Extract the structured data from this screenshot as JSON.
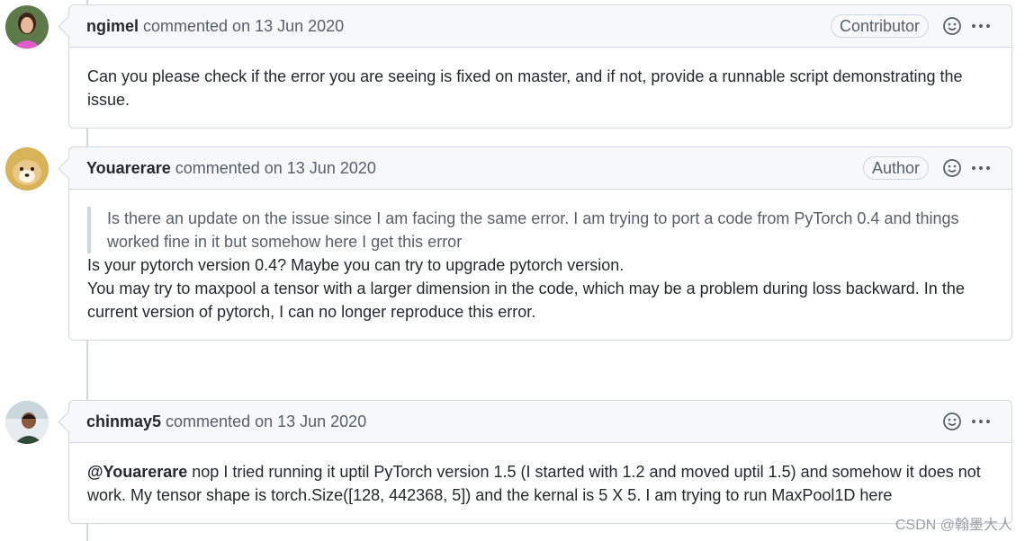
{
  "comments": [
    {
      "author": "ngimel",
      "meta": "commented on 13 Jun 2020",
      "badge": "Contributor",
      "body": "Can you please check if the error you are seeing is fixed on master, and if not, provide a runnable script demonstrating the issue."
    },
    {
      "author": "Youarerare",
      "meta": "commented on 13 Jun 2020",
      "badge": "Author",
      "quote": "Is there an update on the issue since I am facing the same error. I am trying to port a code from PyTorch 0.4 and things worked fine in it but somehow here I get this error",
      "body_line1": "Is your pytorch version 0.4? Maybe you can try to upgrade pytorch version.",
      "body_line2": "You may try to maxpool a tensor with a larger dimension in the code, which may be a problem during loss backward. In the current version of pytorch, I can no longer reproduce this error."
    },
    {
      "author": "chinmay5",
      "meta": "commented on 13 Jun 2020",
      "mention": "@Youarerare",
      "body": " nop I tried running it uptil PyTorch version 1.5 (I started with 1.2 and moved uptil 1.5) and somehow it does not work. My tensor shape is torch.Size([128, 442368, 5]) and the kernal is 5 X 5. I am trying to run MaxPool1D here"
    }
  ],
  "icons": {
    "reaction": "smiley-icon",
    "more": "kebab-horizontal-icon"
  },
  "watermark": "CSDN @翰墨大人"
}
